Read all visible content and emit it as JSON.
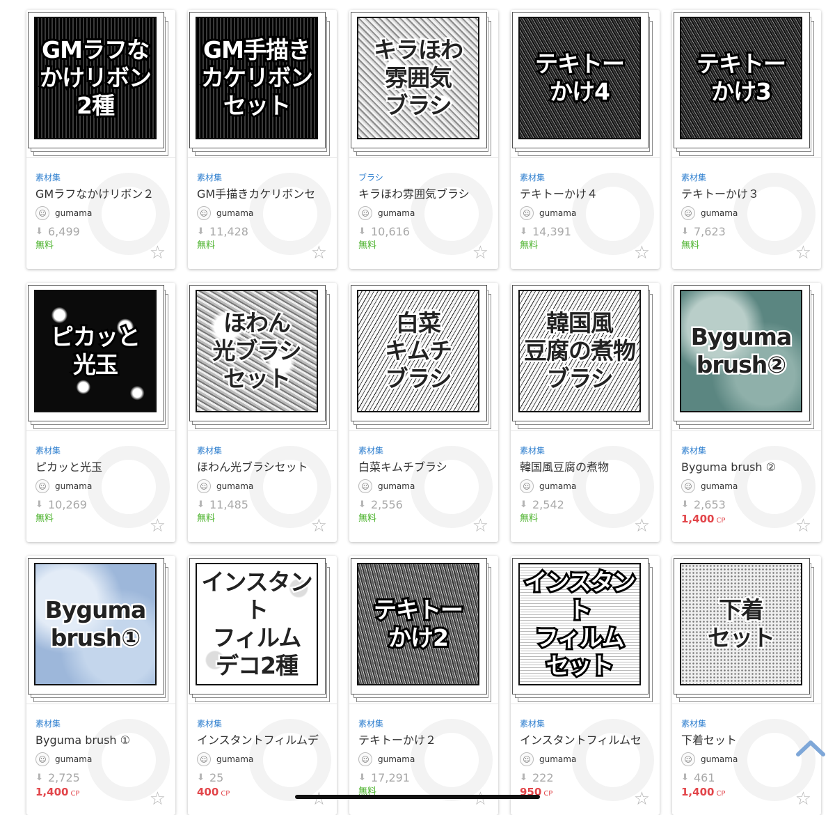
{
  "colors": {
    "category": "#2f7fcf",
    "free": "#4db32e",
    "paid": "#e2454a",
    "muted": "#a8a8a8"
  },
  "icons": {
    "download": "download-icon",
    "favorite": "star-outline-icon",
    "avatar": "user-avatar-icon",
    "scroll_top": "chevron-up-icon"
  },
  "cards": [
    {
      "thumb_text": "GMラフな\nかけリボン\n2種",
      "style": "dark-rays",
      "category": "素材集",
      "title": "GMラフなかけリボン２",
      "author": "gumama",
      "downloads": "6,499",
      "price": "無料",
      "price_unit": "",
      "is_free": true
    },
    {
      "thumb_text": "GM手描き\nカケリボン\nセット",
      "style": "dark-rays",
      "category": "素材集",
      "title": "GM手描きカケリボンセ",
      "author": "gumama",
      "downloads": "11,428",
      "price": "無料",
      "price_unit": "",
      "is_free": true
    },
    {
      "thumb_text": "キラほわ\n雰囲気\nブラシ",
      "style": "sparkle-light",
      "category": "ブラシ",
      "title": "キラほわ雰囲気ブラシ",
      "author": "gumama",
      "downloads": "10,616",
      "price": "無料",
      "price_unit": "",
      "is_free": true
    },
    {
      "thumb_text": "テキトー\nかけ4",
      "style": "scratch-dark",
      "category": "素材集",
      "title": "テキトーかけ４",
      "author": "gumama",
      "downloads": "14,391",
      "price": "無料",
      "price_unit": "",
      "is_free": true
    },
    {
      "thumb_text": "テキトー\nかけ3",
      "style": "scratch-dark",
      "category": "素材集",
      "title": "テキトーかけ３",
      "author": "gumama",
      "downloads": "7,623",
      "price": "無料",
      "price_unit": "",
      "is_free": true
    },
    {
      "thumb_text": "ピカッと\n光玉",
      "style": "stars-dark",
      "category": "素材集",
      "title": "ピカッと光玉",
      "author": "gumama",
      "downloads": "10,269",
      "price": "無料",
      "price_unit": "",
      "is_free": true
    },
    {
      "thumb_text": "ほわん\n光ブラシ\nセット",
      "style": "bokeh-light",
      "category": "素材集",
      "title": "ほわん光ブラシセット",
      "author": "gumama",
      "downloads": "11,485",
      "price": "無料",
      "price_unit": "",
      "is_free": true
    },
    {
      "thumb_text": "白菜\nキムチ\nブラシ",
      "style": "leaf-light",
      "category": "素材集",
      "title": "白菜キムチブラシ",
      "author": "gumama",
      "downloads": "2,556",
      "price": "無料",
      "price_unit": "",
      "is_free": true
    },
    {
      "thumb_text": "韓国風\n豆腐の煮物\nブラシ",
      "style": "leaf-light",
      "category": "素材集",
      "title": "韓国風豆腐の煮物",
      "author": "gumama",
      "downloads": "2,542",
      "price": "無料",
      "price_unit": "",
      "is_free": true
    },
    {
      "thumb_text": "Byguma\nbrush②",
      "style": "teal-texture",
      "category": "素材集",
      "title": "Byguma brush ②",
      "author": "gumama",
      "downloads": "2,653",
      "price": "1,400",
      "price_unit": "CP",
      "is_free": false
    },
    {
      "thumb_text": "Byguma\nbrush①",
      "style": "blue-texture",
      "category": "素材集",
      "title": "Byguma brush ①",
      "author": "gumama",
      "downloads": "2,725",
      "price": "1,400",
      "price_unit": "CP",
      "is_free": false
    },
    {
      "thumb_text": "インスタント\nフィルム\nデコ2種",
      "style": "deco-white",
      "category": "素材集",
      "title": "インスタントフィルムデ",
      "author": "gumama",
      "downloads": "25",
      "price": "400",
      "price_unit": "CP",
      "is_free": false
    },
    {
      "thumb_text": "テキトー\nかけ2",
      "style": "scratch-mid",
      "category": "素材集",
      "title": "テキトーかけ２",
      "author": "gumama",
      "downloads": "17,291",
      "price": "無料",
      "price_unit": "",
      "is_free": true
    },
    {
      "thumb_text": "インスタント\nフィルム\nセット",
      "style": "film-dark",
      "category": "素材集",
      "title": "インスタントフィルムセ",
      "author": "gumama",
      "downloads": "222",
      "price": "950",
      "price_unit": "CP",
      "is_free": false
    },
    {
      "thumb_text": "下着\nセット",
      "style": "lace-light",
      "category": "素材集",
      "title": "下着セット",
      "author": "gumama",
      "downloads": "461",
      "price": "1,400",
      "price_unit": "CP",
      "is_free": false
    }
  ]
}
